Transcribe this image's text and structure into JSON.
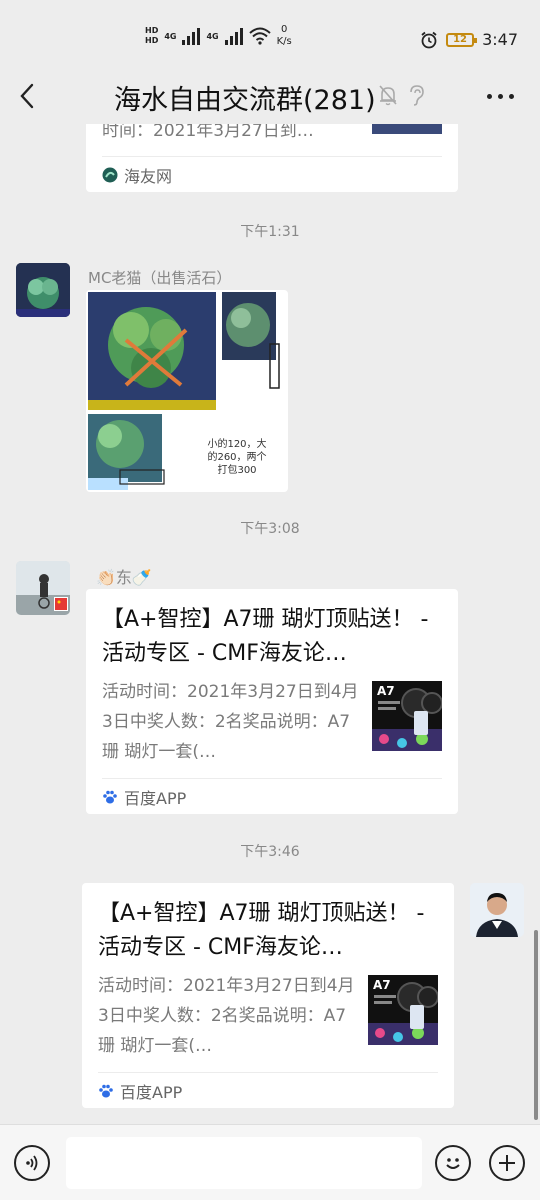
{
  "status_bar": {
    "hd1": "HD",
    "hd2": "HD",
    "net1": "4G",
    "net2": "4G",
    "speed_value": "0",
    "speed_unit": "K/s",
    "battery": "12",
    "time": "3:47"
  },
  "header": {
    "title": "海水自由交流群(281)"
  },
  "messages": {
    "card0": {
      "desc_tail": "时间：2021年3月27日到…",
      "source": "海友网"
    },
    "time1": "下午1:31",
    "msg1": {
      "sender": "MC老猫（出售活石）",
      "image_caption": "小的120，大的260，两个打包300"
    },
    "time2": "下午3:08",
    "msg2": {
      "sender": "👏🏻东🍼",
      "title": "【A+智控】A7珊 瑚灯顶贴送！ - 活动专区 - CMF海友论…",
      "desc": "活动时间：2021年3月27日到4月3日中奖人数：2名奖品说明：A7珊 瑚灯一套(…",
      "thumb_label": "A7",
      "source": "百度APP"
    },
    "time3": "下午3:46",
    "msg3": {
      "title": "【A+智控】A7珊 瑚灯顶贴送！ - 活动专区 - CMF海友论…",
      "desc": "活动时间：2021年3月27日到4月3日中奖人数：2名奖品说明：A7珊 瑚灯一套(…",
      "thumb_label": "A7",
      "source": "百度APP"
    }
  },
  "icons": {
    "back": "chevron-left-icon",
    "mute": "bell-off-icon",
    "earpiece": "ear-icon",
    "more": "more-icon",
    "voice": "voice-icon",
    "emoji": "emoji-icon",
    "plus": "plus-icon"
  },
  "colors": {
    "background": "#ededed",
    "card": "#ffffff",
    "battery_low": "#c48a10",
    "baidu_blue": "#2e6de6"
  }
}
